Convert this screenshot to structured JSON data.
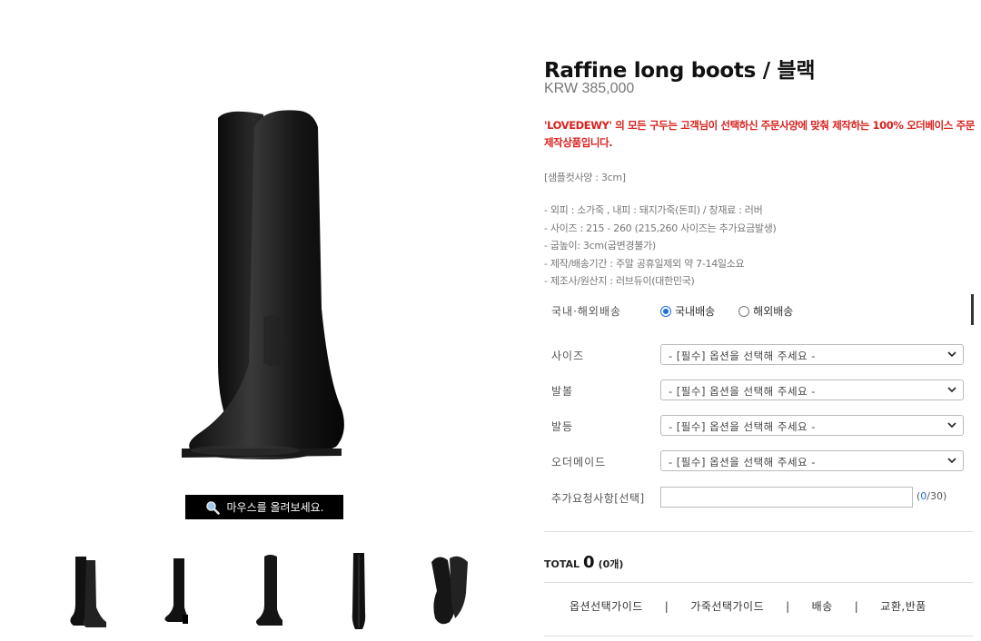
{
  "product": {
    "title": "Raffine long boots / 블랙",
    "price": "KRW 385,000",
    "notice_brand": "'LOVEDEWY'",
    "notice_rest": " 의 모든 구두는 고객님이 선택하신 주문사양에 맞춰 제작하는 100% 오더베이스 주문제작상품입니다.",
    "sample_spec": "[샘플컷사양 : 3cm]",
    "specs": [
      "- 외피 : 소가죽 , 내피 : 돼지가죽(돈피)  / 창재료 : 러버",
      "- 사이즈 : 215 - 260 (215,260 사이즈는 추가요금발생)",
      "- 굽높이: 3cm(굽변경불가)",
      "- 제작/배송기간 : 주말 공휴일제외 약 7-14일소요",
      "- 제조사/원산지 : 러브듀이(대한민국)"
    ]
  },
  "zoom_hint": "마우스를 올려보세요.",
  "shipping": {
    "label": "국내·해외배송",
    "options": [
      "국내배송",
      "해외배송"
    ],
    "selected": "국내배송"
  },
  "options": [
    {
      "label": "사이즈",
      "value": "- [필수] 옵션을 선택해 주세요 -"
    },
    {
      "label": "발볼",
      "value": "- [필수] 옵션을 선택해 주세요 -"
    },
    {
      "label": "발등",
      "value": "- [필수] 옵션을 선택해 주세요 -"
    },
    {
      "label": "오더메이드",
      "value": "- [필수] 옵션을 선택해 주세요 -"
    }
  ],
  "extra_request": {
    "label": "추가요청사항[선택]",
    "value": "",
    "counter_current": "0",
    "counter_max": "/30)",
    "counter_open": "("
  },
  "total": {
    "label": "TOTAL",
    "amount": "0",
    "count": "(0개)"
  },
  "tabs": [
    "옵션선택가이드",
    "가죽선택가이드",
    "배송",
    "교환,반품"
  ],
  "colors": {
    "accent": "#1a6fd8",
    "notice": "#d8231f"
  }
}
